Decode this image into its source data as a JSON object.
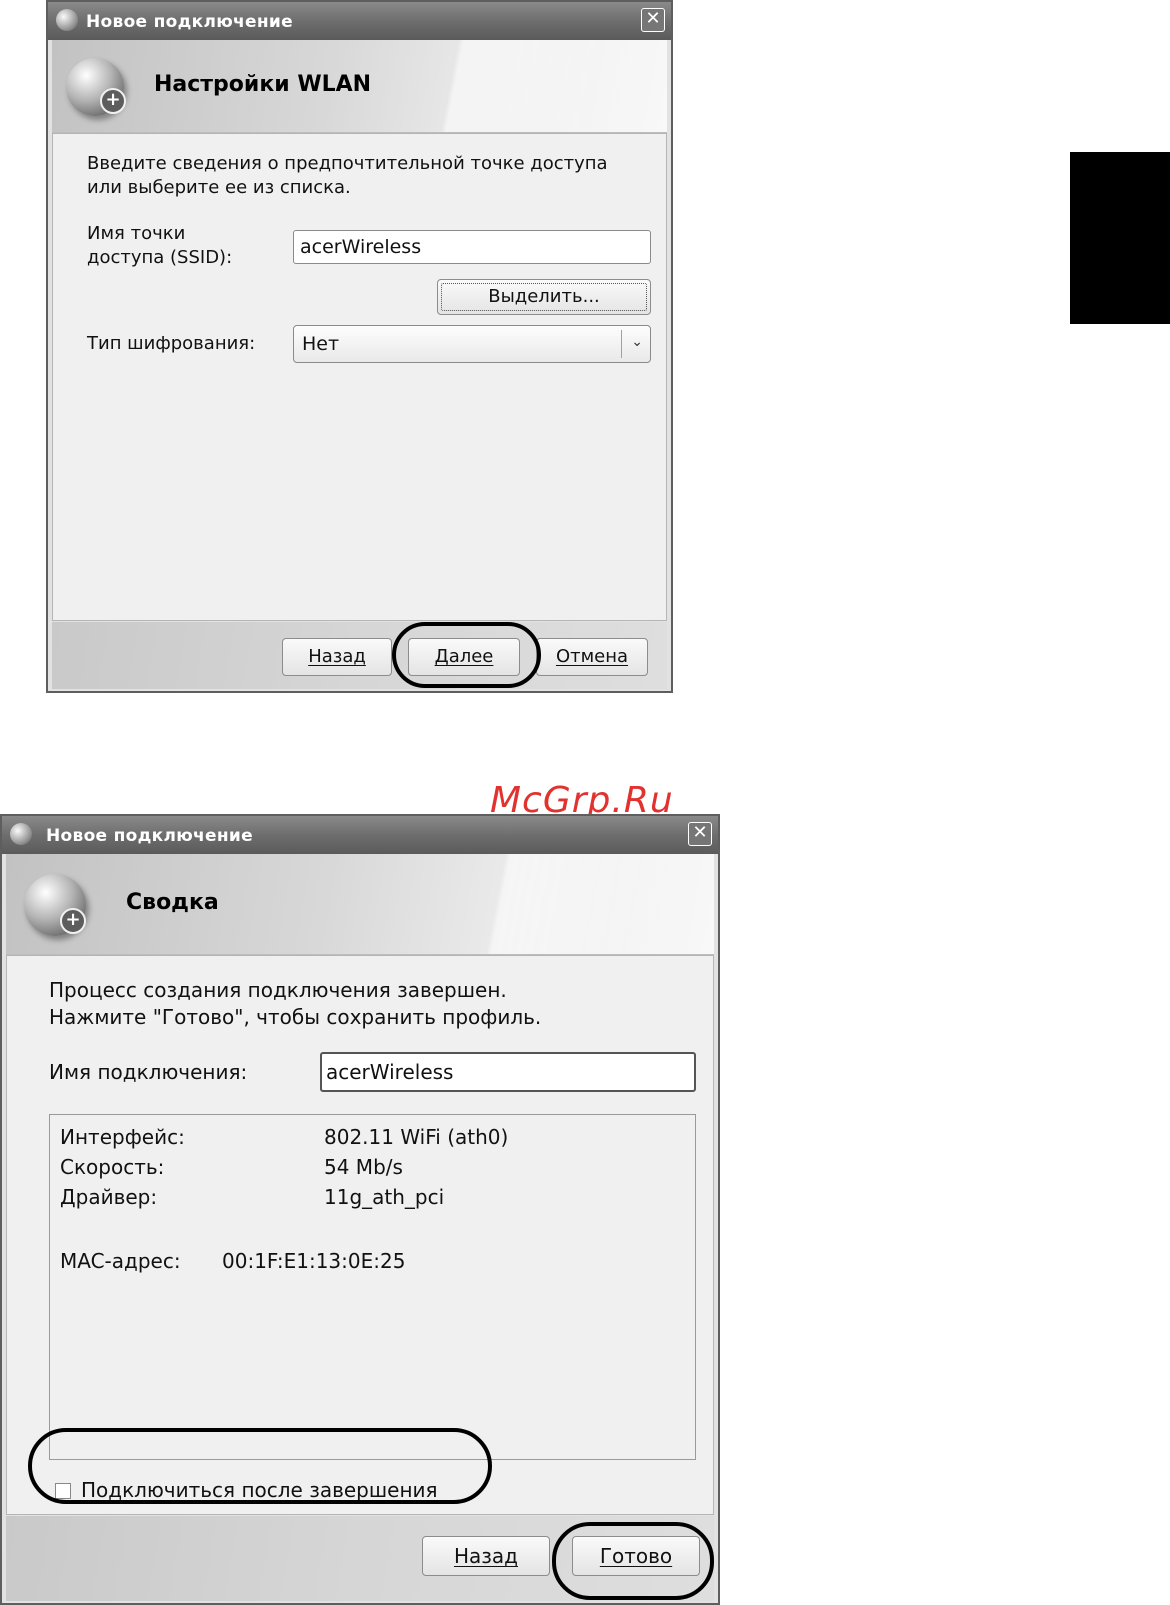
{
  "dialog1": {
    "title": "Новое подключение",
    "close_glyph": "✕",
    "header": "Настройки WLAN",
    "description_line1": "Введите сведения о предпочтительной точке доступа",
    "description_line2": "или выберите ее из списка.",
    "ssid_label_line1": "Имя точки",
    "ssid_label_line2": "доступа (SSID):",
    "ssid_value": "acerWireless",
    "select_button": "Выделить...",
    "encryption_label": "Тип шифрования:",
    "encryption_value": "Нет",
    "back_button": "Назад",
    "next_button": "Далее",
    "cancel_button": "Отмена"
  },
  "dialog2": {
    "title": "Новое подключение",
    "close_glyph": "✕",
    "header": "Сводка",
    "message_line1": "Процесс создания подключения завершен.",
    "message_line2": "Нажмите \"Готово\", чтобы сохранить профиль.",
    "connection_name_label": "Имя подключения:",
    "connection_name_value": "acerWireless",
    "info": {
      "interface_label": "Интерфейс:",
      "interface_value": "802.11 WiFi (ath0)",
      "speed_label": "Скорость:",
      "speed_value": "54 Mb/s",
      "driver_label": "Драйвер:",
      "driver_value": "11g_ath_pci",
      "mac_label": "MAC-адрес:",
      "mac_value": "00:1F:E1:13:0E:25"
    },
    "connect_checkbox_label": "Подключиться после завершения",
    "connect_checked": false,
    "back_button": "Назад",
    "finish_button": "Готово"
  },
  "watermark": "McGrp.Ru",
  "colors": {
    "watermark": "#e1322f",
    "titlebar": "#6e6e6e",
    "highlight_ring": "#000000"
  },
  "icons": {
    "dialog_icon": "globe-plus-icon",
    "titlebar_icon": "globe-icon",
    "close": "close-icon",
    "combo_arrow": "chevron-down-icon"
  }
}
